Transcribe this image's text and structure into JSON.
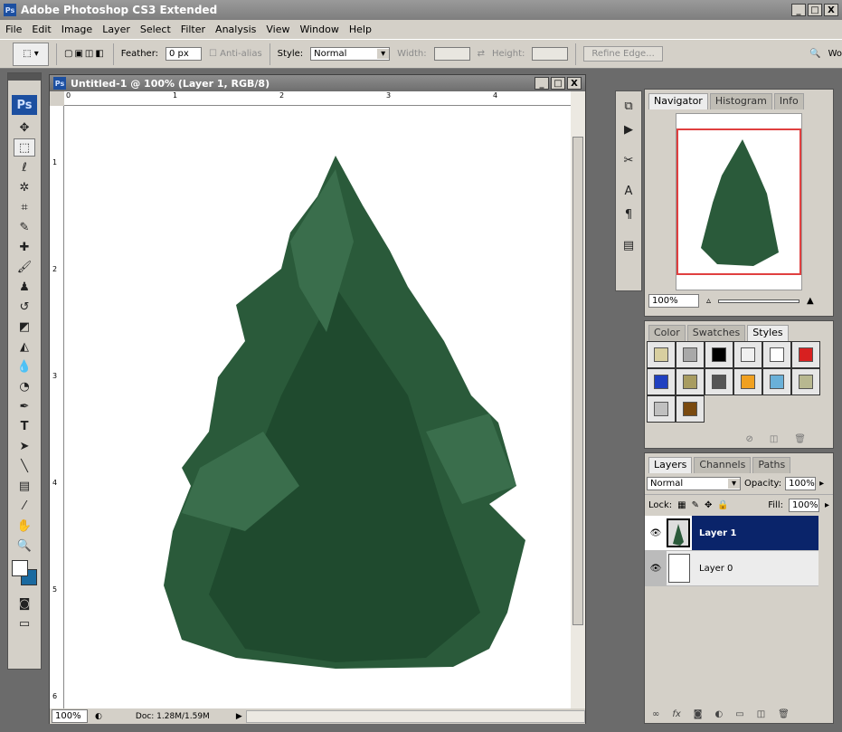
{
  "app": {
    "title": "Adobe Photoshop CS3 Extended",
    "logo": "Ps",
    "window_buttons": [
      "_",
      "□",
      "X"
    ]
  },
  "menu": [
    "File",
    "Edit",
    "Image",
    "Layer",
    "Select",
    "Filter",
    "Analysis",
    "View",
    "Window",
    "Help"
  ],
  "options": {
    "feather_label": "Feather:",
    "feather_value": "0 px",
    "antialias_label": "Anti-alias",
    "style_label": "Style:",
    "style_value": "Normal",
    "width_label": "Width:",
    "height_label": "Height:",
    "refine_edge": "Refine Edge...",
    "workspace": "Wo"
  },
  "document": {
    "title": "Untitled-1 @ 100% (Layer 1, RGB/8)",
    "ruler_top": [
      "0",
      "1",
      "2",
      "3",
      "4"
    ],
    "ruler_left": [
      "1",
      "2",
      "3",
      "4",
      "5",
      "6"
    ],
    "zoom": "100%",
    "doc_info": "Doc: 1.28M/1.59M"
  },
  "toolbox": {
    "logo": "Ps",
    "tools": [
      "move",
      "marquee",
      "lasso",
      "magic-wand",
      "crop",
      "slice",
      "healing",
      "brush",
      "stamp",
      "history-brush",
      "eraser",
      "bucket",
      "blur",
      "dodge",
      "pen",
      "type",
      "path-select",
      "line",
      "notes",
      "eyedropper",
      "hand",
      "zoom"
    ]
  },
  "navigator": {
    "tabs": [
      "Navigator",
      "Histogram",
      "Info"
    ],
    "zoom": "100%"
  },
  "styles": {
    "tabs": [
      "Color",
      "Swatches",
      "Styles"
    ],
    "swatch_colors": [
      "#d8cfa0",
      "#a8a8a8",
      "#000000",
      "#f0f0f0",
      "#ffffff",
      "#d82020",
      "#2040c0",
      "#a89c60",
      "#555555",
      "#f0a020",
      "#6ab0d8",
      "#b8b890",
      "#c0c0c0",
      "#7a4a10"
    ]
  },
  "layers": {
    "tabs": [
      "Layers",
      "Channels",
      "Paths"
    ],
    "blend_mode": "Normal",
    "opacity_label": "Opacity:",
    "opacity": "100%",
    "lock_label": "Lock:",
    "fill_label": "Fill:",
    "fill": "100%",
    "items": [
      {
        "name": "Layer 1",
        "selected": true
      },
      {
        "name": "Layer 0",
        "selected": false
      }
    ]
  },
  "colors": {
    "selection": "#0a246a",
    "tree": "#2a5a3a"
  }
}
